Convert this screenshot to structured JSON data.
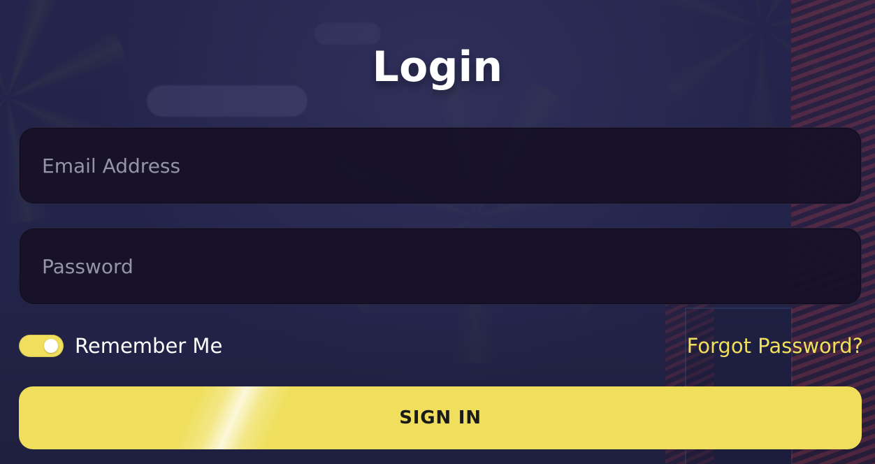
{
  "login": {
    "title": "Login",
    "email": {
      "placeholder": "Email Address",
      "value": ""
    },
    "password": {
      "placeholder": "Password",
      "value": ""
    },
    "remember_me": {
      "label": "Remember Me",
      "checked": true
    },
    "forgot_password_label": "Forgot Password?",
    "sign_in_label": "SIGN IN"
  },
  "theme": {
    "background": "#24234b",
    "field_background": "#161028",
    "accent_yellow": "#efdf5d",
    "text_white": "#ffffff",
    "placeholder_gray": "#bfbfc7"
  },
  "icons": {
    "toggle": "toggle-switch-on"
  }
}
